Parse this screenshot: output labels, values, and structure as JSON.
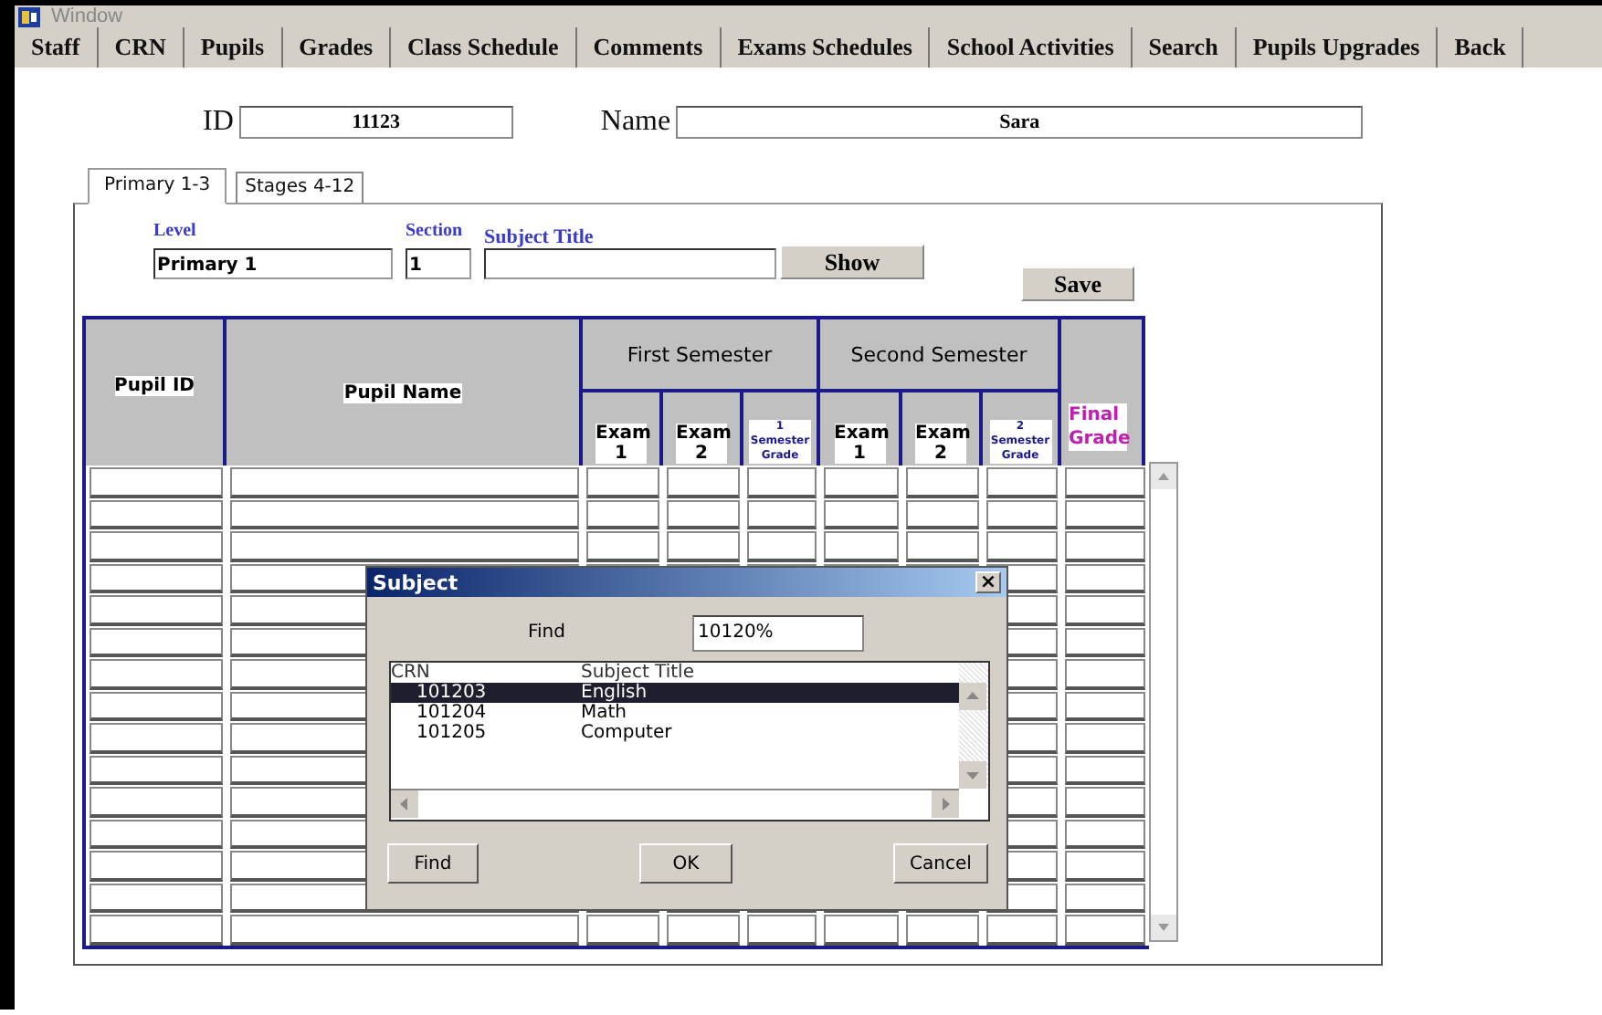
{
  "window": {
    "title": "Window"
  },
  "menu": [
    "Staff",
    "CRN",
    "Pupils",
    "Grades",
    "Class Schedule",
    "Comments",
    "Exams Schedules",
    "School Activities",
    "Search",
    "Pupils Upgrades",
    "Back"
  ],
  "student": {
    "id_label": "ID",
    "id": "11123",
    "name_label": "Name",
    "name": "Sara"
  },
  "tabs": [
    {
      "label": "Primary 1-3",
      "selected": true
    },
    {
      "label": "Stages 4-12",
      "selected": false
    }
  ],
  "filters": {
    "level": {
      "label": "Level",
      "value": "Primary 1"
    },
    "section": {
      "label": "Section",
      "value": "1"
    },
    "subject_title": {
      "label": "Subject Title"
    }
  },
  "buttons": {
    "show": "Show",
    "save": "Save"
  },
  "table": {
    "pupil_id": "Pupil ID",
    "pupil_name": "Pupil Name",
    "semesters": [
      {
        "title": "First Semester",
        "columns": [
          "Exam 1",
          "Exam 2",
          "1 Semester Grade"
        ]
      },
      {
        "title": "Second Semester",
        "columns": [
          "Exam 1",
          "Exam 2",
          "2 Semester Grade"
        ]
      }
    ],
    "final": "Final Grade"
  },
  "dialog": {
    "title": "Subject",
    "close": "×",
    "find_label": "Find",
    "find_value": "10120%",
    "columns": [
      "CRN",
      "Subject Title"
    ],
    "rows": [
      {
        "crn": "101203",
        "title": "English",
        "selected": true
      },
      {
        "crn": "101204",
        "title": "Math",
        "selected": false
      },
      {
        "crn": "101205",
        "title": "Computer",
        "selected": false
      }
    ],
    "buttons": [
      "Find",
      "OK",
      "Cancel"
    ]
  }
}
